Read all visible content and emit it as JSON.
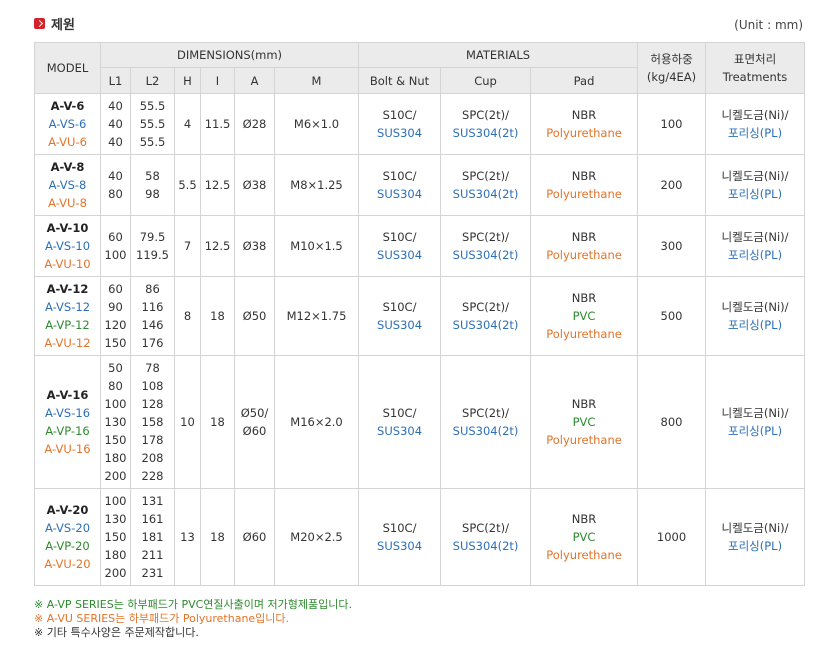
{
  "title": "제원",
  "unit": "(Unit : mm)",
  "headers": {
    "model": "MODEL",
    "dimensions": "DIMENSIONS(mm)",
    "l1": "L1",
    "l2": "L2",
    "h": "H",
    "i": "I",
    "a": "A",
    "m": "M",
    "materials": "MATERIALS",
    "bolt": "Bolt & Nut",
    "cup": "Cup",
    "pad": "Pad",
    "load_line1": "허용하중",
    "load_line2": "(kg/4EA)",
    "treat_line1": "표면처리",
    "treat_line2": "Treatments"
  },
  "rows": [
    {
      "models": [
        {
          "t": "A-V-6",
          "c": "blk"
        },
        {
          "t": "A-VS-6",
          "c": "blu"
        },
        {
          "t": "A-VU-6",
          "c": "org"
        }
      ],
      "l1": [
        "40",
        "40",
        "40"
      ],
      "l2": [
        "55.5",
        "55.5",
        "55.5"
      ],
      "h": "4",
      "i": "11.5",
      "a": [
        "Ø28"
      ],
      "m": "M6×1.0",
      "bolt": [
        {
          "t": "S10C/",
          "c": ""
        },
        {
          "t": "SUS304",
          "c": "blue"
        }
      ],
      "cup": [
        {
          "t": "SPC(2t)/",
          "c": ""
        },
        {
          "t": "SUS304(2t)",
          "c": "blue"
        }
      ],
      "pad": [
        {
          "t": "NBR",
          "c": ""
        },
        {
          "t": "Polyurethane",
          "c": "orange"
        }
      ],
      "load": "100",
      "treat": [
        {
          "t": "니켈도금(Ni)/",
          "c": ""
        },
        {
          "t": "포리싱(PL)",
          "c": "blue"
        }
      ],
      "height": 61
    },
    {
      "models": [
        {
          "t": "A-V-8",
          "c": "blk"
        },
        {
          "t": "A-VS-8",
          "c": "blu"
        },
        {
          "t": "A-VU-8",
          "c": "org"
        }
      ],
      "l1": [
        "40",
        "80"
      ],
      "l2": [
        "58",
        "98"
      ],
      "h": "5.5",
      "i": "12.5",
      "a": [
        "Ø38"
      ],
      "m": "M8×1.25",
      "bolt": [
        {
          "t": "S10C/",
          "c": ""
        },
        {
          "t": "SUS304",
          "c": "blue"
        }
      ],
      "cup": [
        {
          "t": "SPC(2t)/",
          "c": ""
        },
        {
          "t": "SUS304(2t)",
          "c": "blue"
        }
      ],
      "pad": [
        {
          "t": "NBR",
          "c": ""
        },
        {
          "t": "Polyurethane",
          "c": "orange"
        }
      ],
      "load": "200",
      "treat": [
        {
          "t": "니켈도금(Ni)/",
          "c": ""
        },
        {
          "t": "포리싱(PL)",
          "c": "blue"
        }
      ],
      "height": 61
    },
    {
      "models": [
        {
          "t": "A-V-10",
          "c": "blk"
        },
        {
          "t": "A-VS-10",
          "c": "blu"
        },
        {
          "t": "A-VU-10",
          "c": "org"
        }
      ],
      "l1": [
        "60",
        "100"
      ],
      "l2": [
        "79.5",
        "119.5"
      ],
      "h": "7",
      "i": "12.5",
      "a": [
        "Ø38"
      ],
      "m": "M10×1.5",
      "bolt": [
        {
          "t": "S10C/",
          "c": ""
        },
        {
          "t": "SUS304",
          "c": "blue"
        }
      ],
      "cup": [
        {
          "t": "SPC(2t)/",
          "c": ""
        },
        {
          "t": "SUS304(2t)",
          "c": "blue"
        }
      ],
      "pad": [
        {
          "t": "NBR",
          "c": ""
        },
        {
          "t": "Polyurethane",
          "c": "orange"
        }
      ],
      "load": "300",
      "treat": [
        {
          "t": "니켈도금(Ni)/",
          "c": ""
        },
        {
          "t": "포리싱(PL)",
          "c": "blue"
        }
      ],
      "height": 61
    },
    {
      "models": [
        {
          "t": "A-V-12",
          "c": "blk"
        },
        {
          "t": "A-VS-12",
          "c": "blu"
        },
        {
          "t": "A-VP-12",
          "c": "grn"
        },
        {
          "t": "A-VU-12",
          "c": "org"
        }
      ],
      "l1": [
        "60",
        "90",
        "120",
        "150"
      ],
      "l2": [
        "86",
        "116",
        "146",
        "176"
      ],
      "h": "8",
      "i": "18",
      "a": [
        "Ø50"
      ],
      "m": "M12×1.75",
      "bolt": [
        {
          "t": "S10C/",
          "c": ""
        },
        {
          "t": "SUS304",
          "c": "blue"
        }
      ],
      "cup": [
        {
          "t": "SPC(2t)/",
          "c": ""
        },
        {
          "t": "SUS304(2t)",
          "c": "blue"
        }
      ],
      "pad": [
        {
          "t": "NBR",
          "c": ""
        },
        {
          "t": "PVC",
          "c": "green"
        },
        {
          "t": "Polyurethane",
          "c": "orange"
        }
      ],
      "load": "500",
      "treat": [
        {
          "t": "니켈도금(Ni)/",
          "c": ""
        },
        {
          "t": "포리싱(PL)",
          "c": "blue"
        }
      ],
      "height": 79
    },
    {
      "models": [
        {
          "t": "A-V-16",
          "c": "blk"
        },
        {
          "t": "A-VS-16",
          "c": "blu"
        },
        {
          "t": "A-VP-16",
          "c": "grn"
        },
        {
          "t": "A-VU-16",
          "c": "org"
        }
      ],
      "l1": [
        "50",
        "80",
        "100",
        "130",
        "150",
        "180",
        "200"
      ],
      "l2": [
        "78",
        "108",
        "128",
        "158",
        "178",
        "208",
        "228"
      ],
      "h": "10",
      "i": "18",
      "a": [
        "Ø50/",
        "Ø60"
      ],
      "m": "M16×2.0",
      "bolt": [
        {
          "t": "S10C/",
          "c": ""
        },
        {
          "t": "SUS304",
          "c": "blue"
        }
      ],
      "cup": [
        {
          "t": "SPC(2t)/",
          "c": ""
        },
        {
          "t": "SUS304(2t)",
          "c": "blue"
        }
      ],
      "pad": [
        {
          "t": "NBR",
          "c": ""
        },
        {
          "t": "PVC",
          "c": "green"
        },
        {
          "t": "Polyurethane",
          "c": "orange"
        }
      ],
      "load": "800",
      "treat": [
        {
          "t": "니켈도금(Ni)/",
          "c": ""
        },
        {
          "t": "포리싱(PL)",
          "c": "blue"
        }
      ],
      "height": 133
    },
    {
      "models": [
        {
          "t": "A-V-20",
          "c": "blk"
        },
        {
          "t": "A-VS-20",
          "c": "blu"
        },
        {
          "t": "A-VP-20",
          "c": "grn"
        },
        {
          "t": "A-VU-20",
          "c": "org"
        }
      ],
      "l1": [
        "100",
        "130",
        "150",
        "180",
        "200"
      ],
      "l2": [
        "131",
        "161",
        "181",
        "211",
        "231"
      ],
      "h": "13",
      "i": "18",
      "a": [
        "Ø60"
      ],
      "m": "M20×2.5",
      "bolt": [
        {
          "t": "S10C/",
          "c": ""
        },
        {
          "t": "SUS304",
          "c": "blue"
        }
      ],
      "cup": [
        {
          "t": "SPC(2t)/",
          "c": ""
        },
        {
          "t": "SUS304(2t)",
          "c": "blue"
        }
      ],
      "pad": [
        {
          "t": "NBR",
          "c": ""
        },
        {
          "t": "PVC",
          "c": "green"
        },
        {
          "t": "Polyurethane",
          "c": "orange"
        }
      ],
      "load": "1000",
      "treat": [
        {
          "t": "니켈도금(Ni)/",
          "c": ""
        },
        {
          "t": "포리싱(PL)",
          "c": "blue"
        }
      ],
      "height": 97
    }
  ],
  "notes": [
    "※ A-VP SERIES는 하부패드가 PVC연질사출이며 저가형제품입니다.",
    "※ A-VU SERIES는 하부패드가 Polyurethane입니다.",
    "※ 기타 특수사양은 주문제작합니다."
  ],
  "colors": {
    "header_bg": "#ebebeb",
    "border": "#d4d4d4",
    "blue": "#2d6fb6",
    "green": "#2f8a2f",
    "orange": "#e2742a",
    "title_icon": "#d2232a"
  }
}
